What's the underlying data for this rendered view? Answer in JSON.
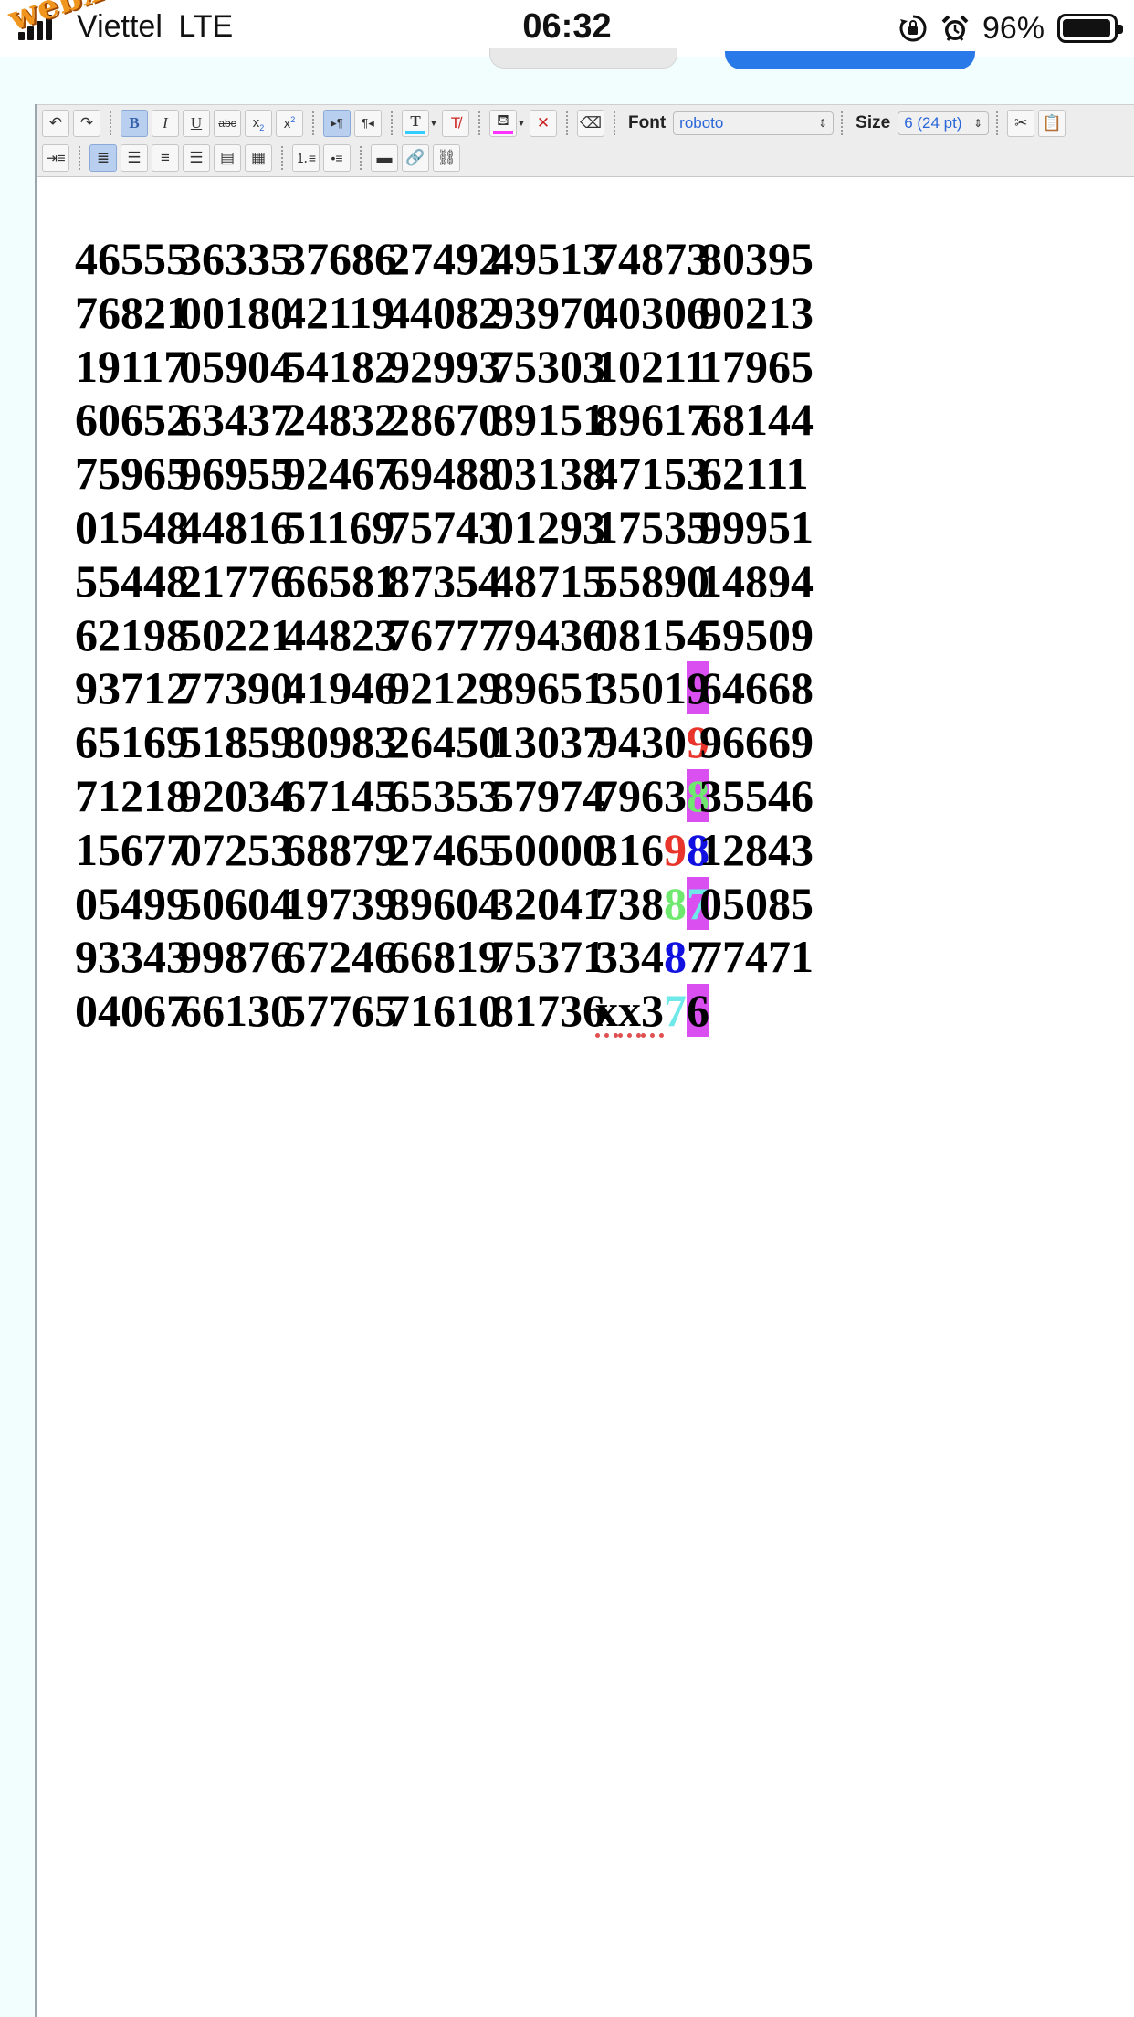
{
  "status_bar": {
    "carrier": "Viettel",
    "network": "LTE",
    "time": "06:32",
    "battery_percent": "96%",
    "battery_level": 0.96,
    "icons": [
      "signal-icon",
      "orientation-lock-icon",
      "alarm-icon",
      "battery-icon"
    ]
  },
  "watermark": "webxoso.net",
  "toolbar": {
    "font_label": "Font",
    "font_value": "roboto",
    "size_label": "Size",
    "size_value": "6 (24 pt)",
    "text_color_letter": "T",
    "highlight_color": "#ff33ff",
    "text_color": "#33ccff"
  },
  "colors": {
    "magenta_highlight": "#d94fef",
    "red": "#e8342a",
    "green": "#6ee86e",
    "blue": "#1010e0",
    "cyan": "#6ee8e8",
    "black": "#000000"
  },
  "grid": {
    "rows": [
      [
        "46555",
        "36335",
        "37686",
        "27492",
        "49513",
        "74873",
        "80395"
      ],
      [
        "76821",
        "00180",
        "42119",
        "44082",
        "93970",
        "40306",
        "90213"
      ],
      [
        "19117",
        "05904",
        "54182",
        "92993",
        "75303",
        "10211",
        "17965"
      ],
      [
        "60652",
        "63437",
        "24832",
        "28670",
        "89151",
        "89617",
        "68144"
      ],
      [
        "75965",
        "96955",
        "92467",
        "69488",
        "03138",
        "47153",
        "62111"
      ],
      [
        "01548",
        "44816",
        "51169",
        "75743",
        "01293",
        "17535",
        "99951"
      ],
      [
        "55448",
        "21776",
        "66581",
        "87354",
        "48715",
        "55890",
        "14894"
      ],
      [
        "62198",
        "50221",
        "44823",
        "76777",
        "79436",
        "08154",
        "59509"
      ],
      [
        "93712",
        "77390",
        "41946",
        "92129",
        "89651",
        "35019",
        "64668"
      ],
      [
        "65169",
        "51859",
        "80983",
        "26450",
        "13037",
        "94309",
        "96669"
      ],
      [
        "71218",
        "92034",
        "67145",
        "65353",
        "57974",
        "79638",
        "35546"
      ],
      [
        "15677",
        "07253",
        "68879",
        "27465",
        "50000",
        "31698",
        "12843"
      ],
      [
        "05499",
        "50604",
        "19739",
        "89604",
        "32041",
        "73887",
        "05085"
      ],
      [
        "93343",
        "99876",
        "67246",
        "66819",
        "75371",
        "33487",
        "77471"
      ],
      [
        "04067",
        "66130",
        "57765",
        "71610",
        "81736",
        "xx376"
      ]
    ],
    "styled_digits": [
      {
        "row": 8,
        "col": 5,
        "pos": 4,
        "color": "black",
        "bg": "magenta_highlight"
      },
      {
        "row": 9,
        "col": 5,
        "pos": 4,
        "color": "red"
      },
      {
        "row": 10,
        "col": 5,
        "pos": 4,
        "color": "green",
        "bg": "magenta_highlight"
      },
      {
        "row": 11,
        "col": 5,
        "pos": 3,
        "color": "red"
      },
      {
        "row": 11,
        "col": 5,
        "pos": 4,
        "color": "blue"
      },
      {
        "row": 12,
        "col": 5,
        "pos": 3,
        "color": "green"
      },
      {
        "row": 12,
        "col": 5,
        "pos": 4,
        "color": "cyan",
        "bg": "magenta_highlight"
      },
      {
        "row": 13,
        "col": 5,
        "pos": 3,
        "color": "blue"
      },
      {
        "row": 14,
        "col": 5,
        "pos": 3,
        "color": "cyan"
      },
      {
        "row": 14,
        "col": 5,
        "pos": 4,
        "color": "black",
        "bg": "magenta_highlight"
      }
    ],
    "spellcheck_cells": [
      {
        "row": 14,
        "col": 5
      }
    ]
  }
}
